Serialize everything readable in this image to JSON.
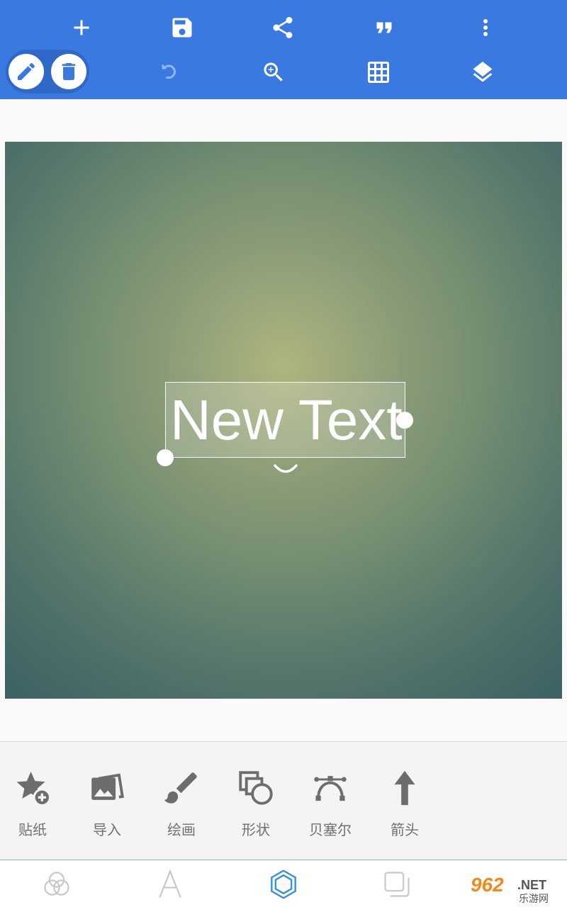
{
  "colors": {
    "toolbar": "#3a7ae0",
    "selection_group": "#3068c8",
    "icon_gray": "#6d6d6d",
    "nav_active": "#3a8fd8",
    "nav_inactive": "#c8c8c8"
  },
  "toolbar": {
    "row1": [
      "plus-icon",
      "save-icon",
      "share-icon",
      "quote-icon",
      "more-vert-icon"
    ],
    "row2": [
      "edit-icon",
      "delete-icon",
      "undo-icon",
      "zoom-in-icon",
      "grid-icon",
      "layers-icon"
    ]
  },
  "canvas": {
    "text_layer": {
      "text": "New Text"
    }
  },
  "tools": [
    {
      "icon": "sticker-icon",
      "label": "贴纸"
    },
    {
      "icon": "import-image-icon",
      "label": "导入"
    },
    {
      "icon": "brush-icon",
      "label": "绘画"
    },
    {
      "icon": "shapes-icon",
      "label": "形状"
    },
    {
      "icon": "bezier-icon",
      "label": "贝塞尔"
    },
    {
      "icon": "arrow-up-icon",
      "label": "箭头"
    }
  ],
  "bottom_nav": {
    "items": [
      "blend-icon",
      "text-icon",
      "hexagon-icon",
      "layer-copy-icon"
    ],
    "active_index": 2
  },
  "watermark": {
    "brand": "962",
    "suffix": ".NET",
    "sub": "乐游网"
  }
}
